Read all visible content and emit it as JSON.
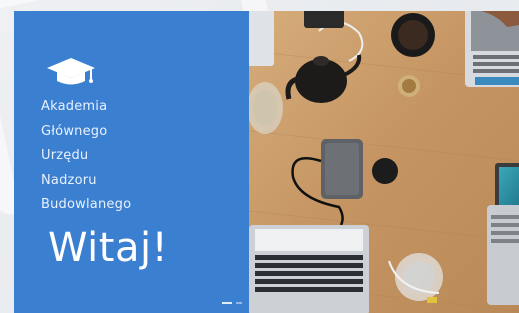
{
  "slide": {
    "academy_name_lines": [
      "Akademia",
      "Głównego",
      "Urzędu",
      "Nadzoru",
      "Budowlanego"
    ],
    "welcome": "Witaj!",
    "icon": "graduation-cap-icon",
    "photo": "desk-with-laptops-photo",
    "colors": {
      "panel": "#3b7fd1",
      "text": "#ffffff",
      "desk": "#c79d6c"
    }
  }
}
